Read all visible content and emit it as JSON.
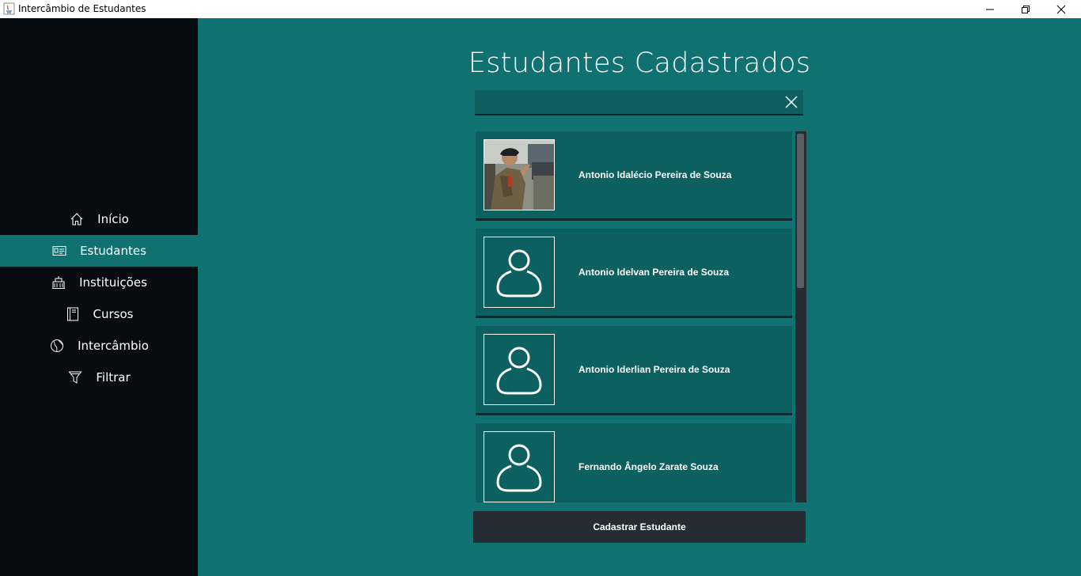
{
  "window": {
    "title": "Intercâmbio de Estudantes",
    "controls": [
      "minimize",
      "restore",
      "close"
    ]
  },
  "sidebar": {
    "items": [
      {
        "label": "Início",
        "icon": "home-icon",
        "active": false
      },
      {
        "label": "Estudantes",
        "icon": "id-card-icon",
        "active": true
      },
      {
        "label": "Instituições",
        "icon": "building-icon",
        "active": false
      },
      {
        "label": "Cursos",
        "icon": "book-icon",
        "active": false
      },
      {
        "label": "Intercâmbio",
        "icon": "globe-icon",
        "active": false
      },
      {
        "label": "Filtrar",
        "icon": "filter-icon",
        "active": false
      }
    ]
  },
  "main": {
    "title": "Estudantes Cadastrados",
    "search": {
      "value": "",
      "placeholder": ""
    },
    "students": [
      {
        "name": "Antonio Idalécio Pereira de Souza",
        "photo": "photo"
      },
      {
        "name": "Antonio Idelvan Pereira de Souza",
        "photo": "default-avatar"
      },
      {
        "name": "Antonio Iderlian Pereira de Souza",
        "photo": "default-avatar"
      },
      {
        "name": "Fernando Ângelo Zarate Souza",
        "photo": "default-avatar"
      }
    ],
    "add_button": "Cadastrar Estudante"
  },
  "colors": {
    "sidebar_bg": "#070c10",
    "main_bg": "#0f7170",
    "card_bg": "#0d6060",
    "active_item": "#0f7170",
    "button_bg": "#262c34"
  }
}
